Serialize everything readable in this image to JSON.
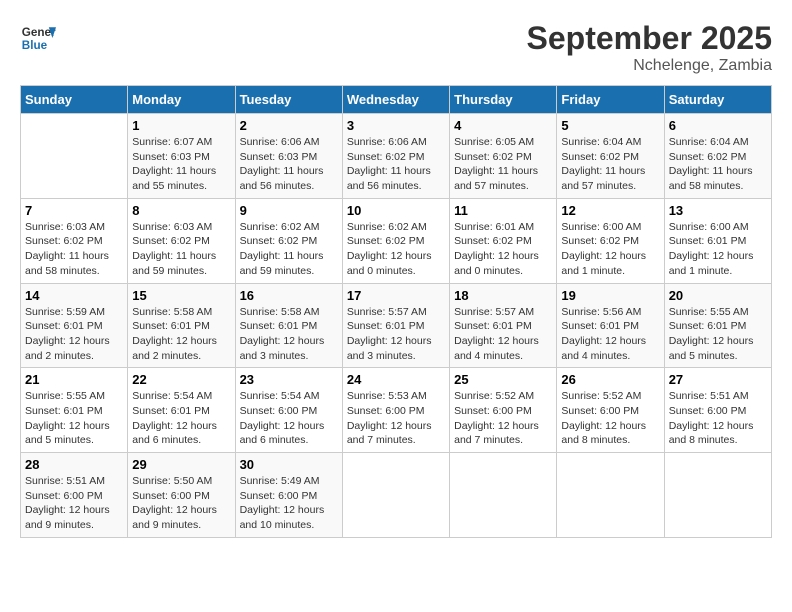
{
  "header": {
    "logo_line1": "General",
    "logo_line2": "Blue",
    "month": "September 2025",
    "location": "Nchelenge, Zambia"
  },
  "weekdays": [
    "Sunday",
    "Monday",
    "Tuesday",
    "Wednesday",
    "Thursday",
    "Friday",
    "Saturday"
  ],
  "weeks": [
    [
      {
        "day": "",
        "info": ""
      },
      {
        "day": "1",
        "info": "Sunrise: 6:07 AM\nSunset: 6:03 PM\nDaylight: 11 hours\nand 55 minutes."
      },
      {
        "day": "2",
        "info": "Sunrise: 6:06 AM\nSunset: 6:03 PM\nDaylight: 11 hours\nand 56 minutes."
      },
      {
        "day": "3",
        "info": "Sunrise: 6:06 AM\nSunset: 6:02 PM\nDaylight: 11 hours\nand 56 minutes."
      },
      {
        "day": "4",
        "info": "Sunrise: 6:05 AM\nSunset: 6:02 PM\nDaylight: 11 hours\nand 57 minutes."
      },
      {
        "day": "5",
        "info": "Sunrise: 6:04 AM\nSunset: 6:02 PM\nDaylight: 11 hours\nand 57 minutes."
      },
      {
        "day": "6",
        "info": "Sunrise: 6:04 AM\nSunset: 6:02 PM\nDaylight: 11 hours\nand 58 minutes."
      }
    ],
    [
      {
        "day": "7",
        "info": "Sunrise: 6:03 AM\nSunset: 6:02 PM\nDaylight: 11 hours\nand 58 minutes."
      },
      {
        "day": "8",
        "info": "Sunrise: 6:03 AM\nSunset: 6:02 PM\nDaylight: 11 hours\nand 59 minutes."
      },
      {
        "day": "9",
        "info": "Sunrise: 6:02 AM\nSunset: 6:02 PM\nDaylight: 11 hours\nand 59 minutes."
      },
      {
        "day": "10",
        "info": "Sunrise: 6:02 AM\nSunset: 6:02 PM\nDaylight: 12 hours\nand 0 minutes."
      },
      {
        "day": "11",
        "info": "Sunrise: 6:01 AM\nSunset: 6:02 PM\nDaylight: 12 hours\nand 0 minutes."
      },
      {
        "day": "12",
        "info": "Sunrise: 6:00 AM\nSunset: 6:02 PM\nDaylight: 12 hours\nand 1 minute."
      },
      {
        "day": "13",
        "info": "Sunrise: 6:00 AM\nSunset: 6:01 PM\nDaylight: 12 hours\nand 1 minute."
      }
    ],
    [
      {
        "day": "14",
        "info": "Sunrise: 5:59 AM\nSunset: 6:01 PM\nDaylight: 12 hours\nand 2 minutes."
      },
      {
        "day": "15",
        "info": "Sunrise: 5:58 AM\nSunset: 6:01 PM\nDaylight: 12 hours\nand 2 minutes."
      },
      {
        "day": "16",
        "info": "Sunrise: 5:58 AM\nSunset: 6:01 PM\nDaylight: 12 hours\nand 3 minutes."
      },
      {
        "day": "17",
        "info": "Sunrise: 5:57 AM\nSunset: 6:01 PM\nDaylight: 12 hours\nand 3 minutes."
      },
      {
        "day": "18",
        "info": "Sunrise: 5:57 AM\nSunset: 6:01 PM\nDaylight: 12 hours\nand 4 minutes."
      },
      {
        "day": "19",
        "info": "Sunrise: 5:56 AM\nSunset: 6:01 PM\nDaylight: 12 hours\nand 4 minutes."
      },
      {
        "day": "20",
        "info": "Sunrise: 5:55 AM\nSunset: 6:01 PM\nDaylight: 12 hours\nand 5 minutes."
      }
    ],
    [
      {
        "day": "21",
        "info": "Sunrise: 5:55 AM\nSunset: 6:01 PM\nDaylight: 12 hours\nand 5 minutes."
      },
      {
        "day": "22",
        "info": "Sunrise: 5:54 AM\nSunset: 6:01 PM\nDaylight: 12 hours\nand 6 minutes."
      },
      {
        "day": "23",
        "info": "Sunrise: 5:54 AM\nSunset: 6:00 PM\nDaylight: 12 hours\nand 6 minutes."
      },
      {
        "day": "24",
        "info": "Sunrise: 5:53 AM\nSunset: 6:00 PM\nDaylight: 12 hours\nand 7 minutes."
      },
      {
        "day": "25",
        "info": "Sunrise: 5:52 AM\nSunset: 6:00 PM\nDaylight: 12 hours\nand 7 minutes."
      },
      {
        "day": "26",
        "info": "Sunrise: 5:52 AM\nSunset: 6:00 PM\nDaylight: 12 hours\nand 8 minutes."
      },
      {
        "day": "27",
        "info": "Sunrise: 5:51 AM\nSunset: 6:00 PM\nDaylight: 12 hours\nand 8 minutes."
      }
    ],
    [
      {
        "day": "28",
        "info": "Sunrise: 5:51 AM\nSunset: 6:00 PM\nDaylight: 12 hours\nand 9 minutes."
      },
      {
        "day": "29",
        "info": "Sunrise: 5:50 AM\nSunset: 6:00 PM\nDaylight: 12 hours\nand 9 minutes."
      },
      {
        "day": "30",
        "info": "Sunrise: 5:49 AM\nSunset: 6:00 PM\nDaylight: 12 hours\nand 10 minutes."
      },
      {
        "day": "",
        "info": ""
      },
      {
        "day": "",
        "info": ""
      },
      {
        "day": "",
        "info": ""
      },
      {
        "day": "",
        "info": ""
      }
    ]
  ]
}
